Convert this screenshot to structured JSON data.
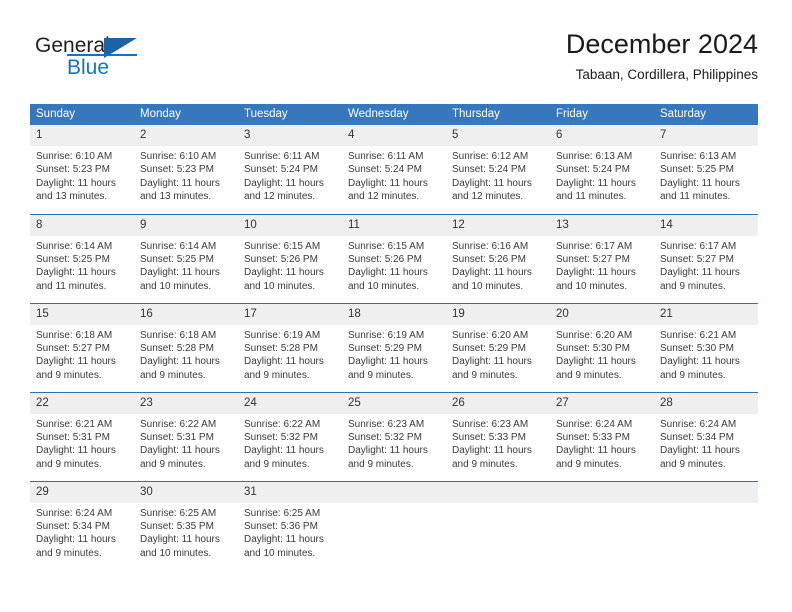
{
  "brand": {
    "name_line1": "General",
    "name_line2": "Blue",
    "logo_icon": "triangle-flag-icon",
    "accent_color": "#1574bb"
  },
  "header": {
    "title": "December 2024",
    "subtitle": "Tabaan, Cordillera, Philippines"
  },
  "calendar": {
    "header_bg": "#3778bc",
    "daynum_bg": "#efefef",
    "separator_color": "#2f6fb2",
    "weekday_headers": [
      "Sunday",
      "Monday",
      "Tuesday",
      "Wednesday",
      "Thursday",
      "Friday",
      "Saturday"
    ],
    "weeks": [
      [
        {
          "day": "1",
          "sunrise": "Sunrise: 6:10 AM",
          "sunset": "Sunset: 5:23 PM",
          "daylight1": "Daylight: 11 hours",
          "daylight2": "and 13 minutes."
        },
        {
          "day": "2",
          "sunrise": "Sunrise: 6:10 AM",
          "sunset": "Sunset: 5:23 PM",
          "daylight1": "Daylight: 11 hours",
          "daylight2": "and 13 minutes."
        },
        {
          "day": "3",
          "sunrise": "Sunrise: 6:11 AM",
          "sunset": "Sunset: 5:24 PM",
          "daylight1": "Daylight: 11 hours",
          "daylight2": "and 12 minutes."
        },
        {
          "day": "4",
          "sunrise": "Sunrise: 6:11 AM",
          "sunset": "Sunset: 5:24 PM",
          "daylight1": "Daylight: 11 hours",
          "daylight2": "and 12 minutes."
        },
        {
          "day": "5",
          "sunrise": "Sunrise: 6:12 AM",
          "sunset": "Sunset: 5:24 PM",
          "daylight1": "Daylight: 11 hours",
          "daylight2": "and 12 minutes."
        },
        {
          "day": "6",
          "sunrise": "Sunrise: 6:13 AM",
          "sunset": "Sunset: 5:24 PM",
          "daylight1": "Daylight: 11 hours",
          "daylight2": "and 11 minutes."
        },
        {
          "day": "7",
          "sunrise": "Sunrise: 6:13 AM",
          "sunset": "Sunset: 5:25 PM",
          "daylight1": "Daylight: 11 hours",
          "daylight2": "and 11 minutes."
        }
      ],
      [
        {
          "day": "8",
          "sunrise": "Sunrise: 6:14 AM",
          "sunset": "Sunset: 5:25 PM",
          "daylight1": "Daylight: 11 hours",
          "daylight2": "and 11 minutes."
        },
        {
          "day": "9",
          "sunrise": "Sunrise: 6:14 AM",
          "sunset": "Sunset: 5:25 PM",
          "daylight1": "Daylight: 11 hours",
          "daylight2": "and 10 minutes."
        },
        {
          "day": "10",
          "sunrise": "Sunrise: 6:15 AM",
          "sunset": "Sunset: 5:26 PM",
          "daylight1": "Daylight: 11 hours",
          "daylight2": "and 10 minutes."
        },
        {
          "day": "11",
          "sunrise": "Sunrise: 6:15 AM",
          "sunset": "Sunset: 5:26 PM",
          "daylight1": "Daylight: 11 hours",
          "daylight2": "and 10 minutes."
        },
        {
          "day": "12",
          "sunrise": "Sunrise: 6:16 AM",
          "sunset": "Sunset: 5:26 PM",
          "daylight1": "Daylight: 11 hours",
          "daylight2": "and 10 minutes."
        },
        {
          "day": "13",
          "sunrise": "Sunrise: 6:17 AM",
          "sunset": "Sunset: 5:27 PM",
          "daylight1": "Daylight: 11 hours",
          "daylight2": "and 10 minutes."
        },
        {
          "day": "14",
          "sunrise": "Sunrise: 6:17 AM",
          "sunset": "Sunset: 5:27 PM",
          "daylight1": "Daylight: 11 hours",
          "daylight2": "and 9 minutes."
        }
      ],
      [
        {
          "day": "15",
          "sunrise": "Sunrise: 6:18 AM",
          "sunset": "Sunset: 5:27 PM",
          "daylight1": "Daylight: 11 hours",
          "daylight2": "and 9 minutes."
        },
        {
          "day": "16",
          "sunrise": "Sunrise: 6:18 AM",
          "sunset": "Sunset: 5:28 PM",
          "daylight1": "Daylight: 11 hours",
          "daylight2": "and 9 minutes."
        },
        {
          "day": "17",
          "sunrise": "Sunrise: 6:19 AM",
          "sunset": "Sunset: 5:28 PM",
          "daylight1": "Daylight: 11 hours",
          "daylight2": "and 9 minutes."
        },
        {
          "day": "18",
          "sunrise": "Sunrise: 6:19 AM",
          "sunset": "Sunset: 5:29 PM",
          "daylight1": "Daylight: 11 hours",
          "daylight2": "and 9 minutes."
        },
        {
          "day": "19",
          "sunrise": "Sunrise: 6:20 AM",
          "sunset": "Sunset: 5:29 PM",
          "daylight1": "Daylight: 11 hours",
          "daylight2": "and 9 minutes."
        },
        {
          "day": "20",
          "sunrise": "Sunrise: 6:20 AM",
          "sunset": "Sunset: 5:30 PM",
          "daylight1": "Daylight: 11 hours",
          "daylight2": "and 9 minutes."
        },
        {
          "day": "21",
          "sunrise": "Sunrise: 6:21 AM",
          "sunset": "Sunset: 5:30 PM",
          "daylight1": "Daylight: 11 hours",
          "daylight2": "and 9 minutes."
        }
      ],
      [
        {
          "day": "22",
          "sunrise": "Sunrise: 6:21 AM",
          "sunset": "Sunset: 5:31 PM",
          "daylight1": "Daylight: 11 hours",
          "daylight2": "and 9 minutes."
        },
        {
          "day": "23",
          "sunrise": "Sunrise: 6:22 AM",
          "sunset": "Sunset: 5:31 PM",
          "daylight1": "Daylight: 11 hours",
          "daylight2": "and 9 minutes."
        },
        {
          "day": "24",
          "sunrise": "Sunrise: 6:22 AM",
          "sunset": "Sunset: 5:32 PM",
          "daylight1": "Daylight: 11 hours",
          "daylight2": "and 9 minutes."
        },
        {
          "day": "25",
          "sunrise": "Sunrise: 6:23 AM",
          "sunset": "Sunset: 5:32 PM",
          "daylight1": "Daylight: 11 hours",
          "daylight2": "and 9 minutes."
        },
        {
          "day": "26",
          "sunrise": "Sunrise: 6:23 AM",
          "sunset": "Sunset: 5:33 PM",
          "daylight1": "Daylight: 11 hours",
          "daylight2": "and 9 minutes."
        },
        {
          "day": "27",
          "sunrise": "Sunrise: 6:24 AM",
          "sunset": "Sunset: 5:33 PM",
          "daylight1": "Daylight: 11 hours",
          "daylight2": "and 9 minutes."
        },
        {
          "day": "28",
          "sunrise": "Sunrise: 6:24 AM",
          "sunset": "Sunset: 5:34 PM",
          "daylight1": "Daylight: 11 hours",
          "daylight2": "and 9 minutes."
        }
      ],
      [
        {
          "day": "29",
          "sunrise": "Sunrise: 6:24 AM",
          "sunset": "Sunset: 5:34 PM",
          "daylight1": "Daylight: 11 hours",
          "daylight2": "and 9 minutes."
        },
        {
          "day": "30",
          "sunrise": "Sunrise: 6:25 AM",
          "sunset": "Sunset: 5:35 PM",
          "daylight1": "Daylight: 11 hours",
          "daylight2": "and 10 minutes."
        },
        {
          "day": "31",
          "sunrise": "Sunrise: 6:25 AM",
          "sunset": "Sunset: 5:36 PM",
          "daylight1": "Daylight: 11 hours",
          "daylight2": "and 10 minutes."
        },
        {
          "day": "",
          "sunrise": "",
          "sunset": "",
          "daylight1": "",
          "daylight2": ""
        },
        {
          "day": "",
          "sunrise": "",
          "sunset": "",
          "daylight1": "",
          "daylight2": ""
        },
        {
          "day": "",
          "sunrise": "",
          "sunset": "",
          "daylight1": "",
          "daylight2": ""
        },
        {
          "day": "",
          "sunrise": "",
          "sunset": "",
          "daylight1": "",
          "daylight2": ""
        }
      ]
    ]
  }
}
